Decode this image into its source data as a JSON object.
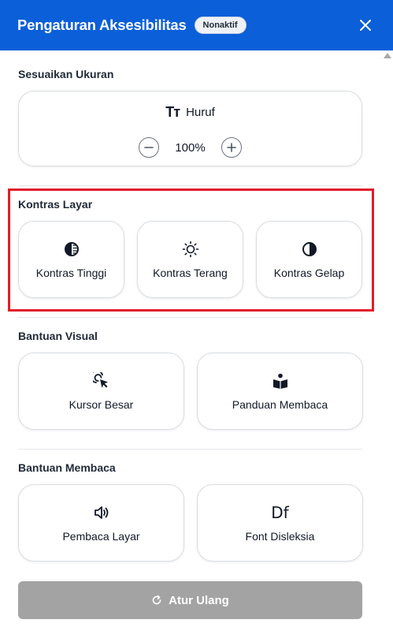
{
  "header": {
    "title": "Pengaturan Aksesibilitas",
    "status_badge": "Nonaktif",
    "close_icon": "close-icon",
    "background_color": "#0b5fd9"
  },
  "font_size": {
    "section_title": "Sesuaikan Ukuran",
    "label": "Huruf",
    "icon_text": "Tт",
    "zoom_value": "100%"
  },
  "contrast": {
    "section_title": "Kontras Layar",
    "options": [
      {
        "label": "Kontras Tinggi",
        "icon": "high-contrast-icon"
      },
      {
        "label": "Kontras Terang",
        "icon": "sun-icon"
      },
      {
        "label": "Kontras Gelap",
        "icon": "dark-contrast-icon"
      }
    ]
  },
  "visual_aid": {
    "section_title": "Bantuan Visual",
    "options": [
      {
        "label": "Kursor Besar",
        "icon": "cursor-icon"
      },
      {
        "label": "Panduan Membaca",
        "icon": "reading-guide-icon"
      }
    ]
  },
  "reading_aid": {
    "section_title": "Bantuan Membaca",
    "options": [
      {
        "label": "Pembaca Layar",
        "icon": "speaker-icon"
      },
      {
        "label": "Font Disleksia",
        "icon": "dyslexia-font-icon",
        "icon_text": "Df"
      }
    ]
  },
  "reset": {
    "label": "Atur Ulang",
    "icon": "reset-icon"
  },
  "colors": {
    "highlight": "#e11d2a",
    "reset_button": "#a3a3a3"
  }
}
